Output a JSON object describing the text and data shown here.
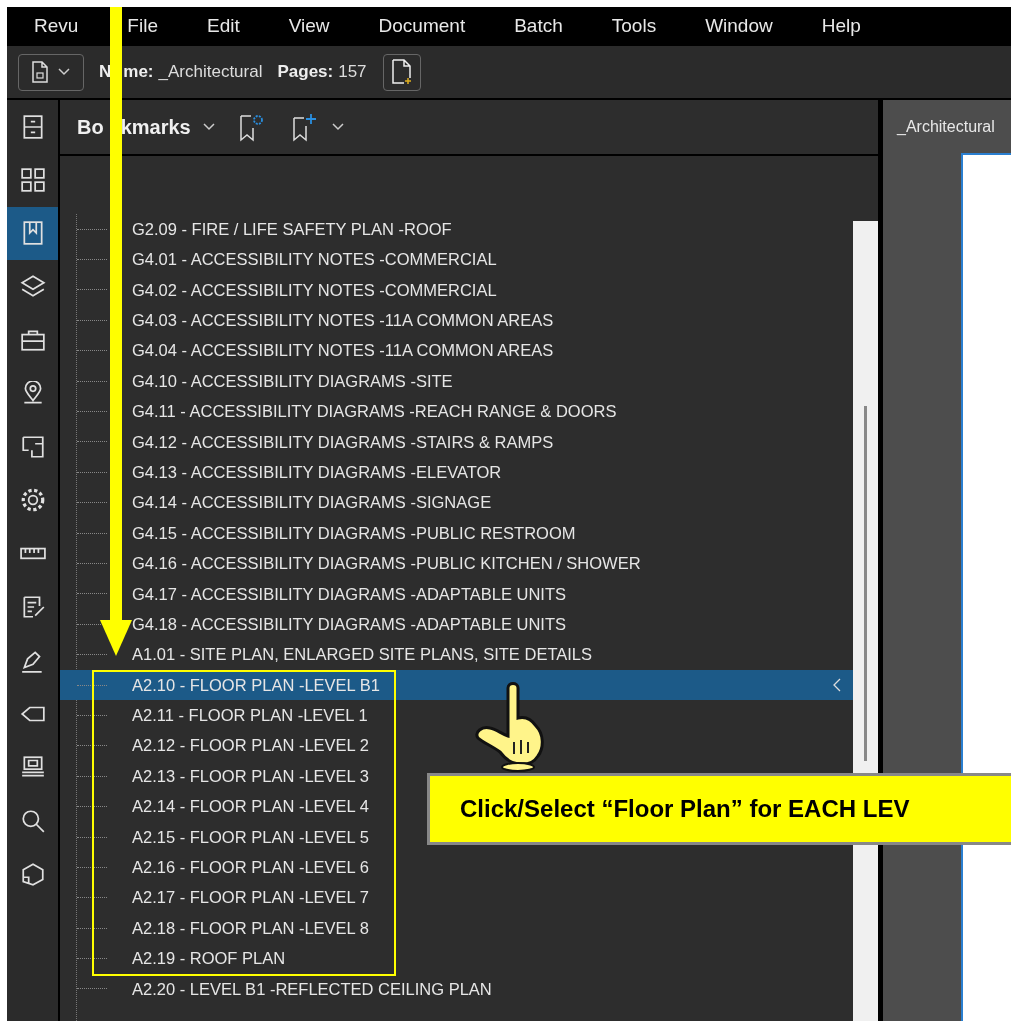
{
  "menu": [
    "Revu",
    "File",
    "Edit",
    "View",
    "Document",
    "Batch",
    "Tools",
    "Window",
    "Help"
  ],
  "toolbar": {
    "name_label": [
      "N",
      "me:"
    ],
    "name_value": "_Architectural",
    "pages_label": "Pages:",
    "pages_value": "157"
  },
  "side_icons": [
    {
      "selected": false
    },
    {
      "selected": false
    },
    {
      "selected": true
    },
    {
      "selected": false
    },
    {
      "selected": false
    },
    {
      "selected": false
    },
    {
      "selected": false
    },
    {
      "selected": false
    },
    {
      "selected": false
    },
    {
      "selected": false
    },
    {
      "selected": false
    },
    {
      "selected": false
    },
    {
      "selected": false
    },
    {
      "selected": false
    },
    {
      "selected": false
    }
  ],
  "panel": {
    "title": [
      "Bo",
      "kmarks"
    ]
  },
  "bookmarks": [
    {
      "label": "G2.09 - FIRE / LIFE SAFETY PLAN -ROOF",
      "selected": false
    },
    {
      "label": "G4.01 - ACCESSIBILITY NOTES -COMMERCIAL",
      "selected": false
    },
    {
      "label": "G4.02 - ACCESSIBILITY NOTES -COMMERCIAL",
      "selected": false
    },
    {
      "label": "G4.03 - ACCESSIBILITY NOTES -11A COMMON AREAS",
      "selected": false
    },
    {
      "label": "G4.04 - ACCESSIBILITY NOTES -11A COMMON AREAS",
      "selected": false
    },
    {
      "label": "G4.10 - ACCESSIBILITY DIAGRAMS -SITE",
      "selected": false
    },
    {
      "label": "G4.11 - ACCESSIBILITY DIAGRAMS -REACH RANGE & DOORS",
      "selected": false
    },
    {
      "label": "G4.12 - ACCESSIBILITY DIAGRAMS -STAIRS & RAMPS",
      "selected": false
    },
    {
      "label": "G4.13 - ACCESSIBILITY DIAGRAMS -ELEVATOR",
      "selected": false
    },
    {
      "label": "G4.14 - ACCESSIBILITY DIAGRAMS -SIGNAGE",
      "selected": false
    },
    {
      "label": "G4.15 - ACCESSIBILITY DIAGRAMS -PUBLIC RESTROOM",
      "selected": false
    },
    {
      "label": "G4.16 - ACCESSIBILITY DIAGRAMS -PUBLIC KITCHEN / SHOWER",
      "selected": false
    },
    {
      "label": "G4.17 - ACCESSIBILITY DIAGRAMS -ADAPTABLE UNITS",
      "selected": false
    },
    {
      "label": "G4.18 - ACCESSIBILITY DIAGRAMS -ADAPTABLE UNITS",
      "selected": false
    },
    {
      "label": "A1.01 - SITE PLAN, ENLARGED SITE PLANS, SITE DETAILS",
      "selected": false
    },
    {
      "label": "A2.10 - FLOOR PLAN -LEVEL B1",
      "selected": true
    },
    {
      "label": "A2.11 - FLOOR PLAN -LEVEL 1",
      "selected": false
    },
    {
      "label": "A2.12 - FLOOR PLAN -LEVEL 2",
      "selected": false
    },
    {
      "label": "A2.13 - FLOOR PLAN -LEVEL 3",
      "selected": false
    },
    {
      "label": "A2.14 - FLOOR PLAN -LEVEL 4",
      "selected": false
    },
    {
      "label": "A2.15 - FLOOR PLAN -LEVEL 5",
      "selected": false
    },
    {
      "label": "A2.16 - FLOOR PLAN -LEVEL 6",
      "selected": false
    },
    {
      "label": "A2.17 - FLOOR PLAN -LEVEL 7",
      "selected": false
    },
    {
      "label": "A2.18 - FLOOR PLAN -LEVEL 8",
      "selected": false
    },
    {
      "label": "A2.19 - ROOF PLAN",
      "selected": false
    },
    {
      "label": "A2.20 - LEVEL B1 -REFLECTED CEILING PLAN",
      "selected": false
    }
  ],
  "document_tab": "_Architectural",
  "callout": "Click/Select “Floor Plan” for EACH LEV"
}
